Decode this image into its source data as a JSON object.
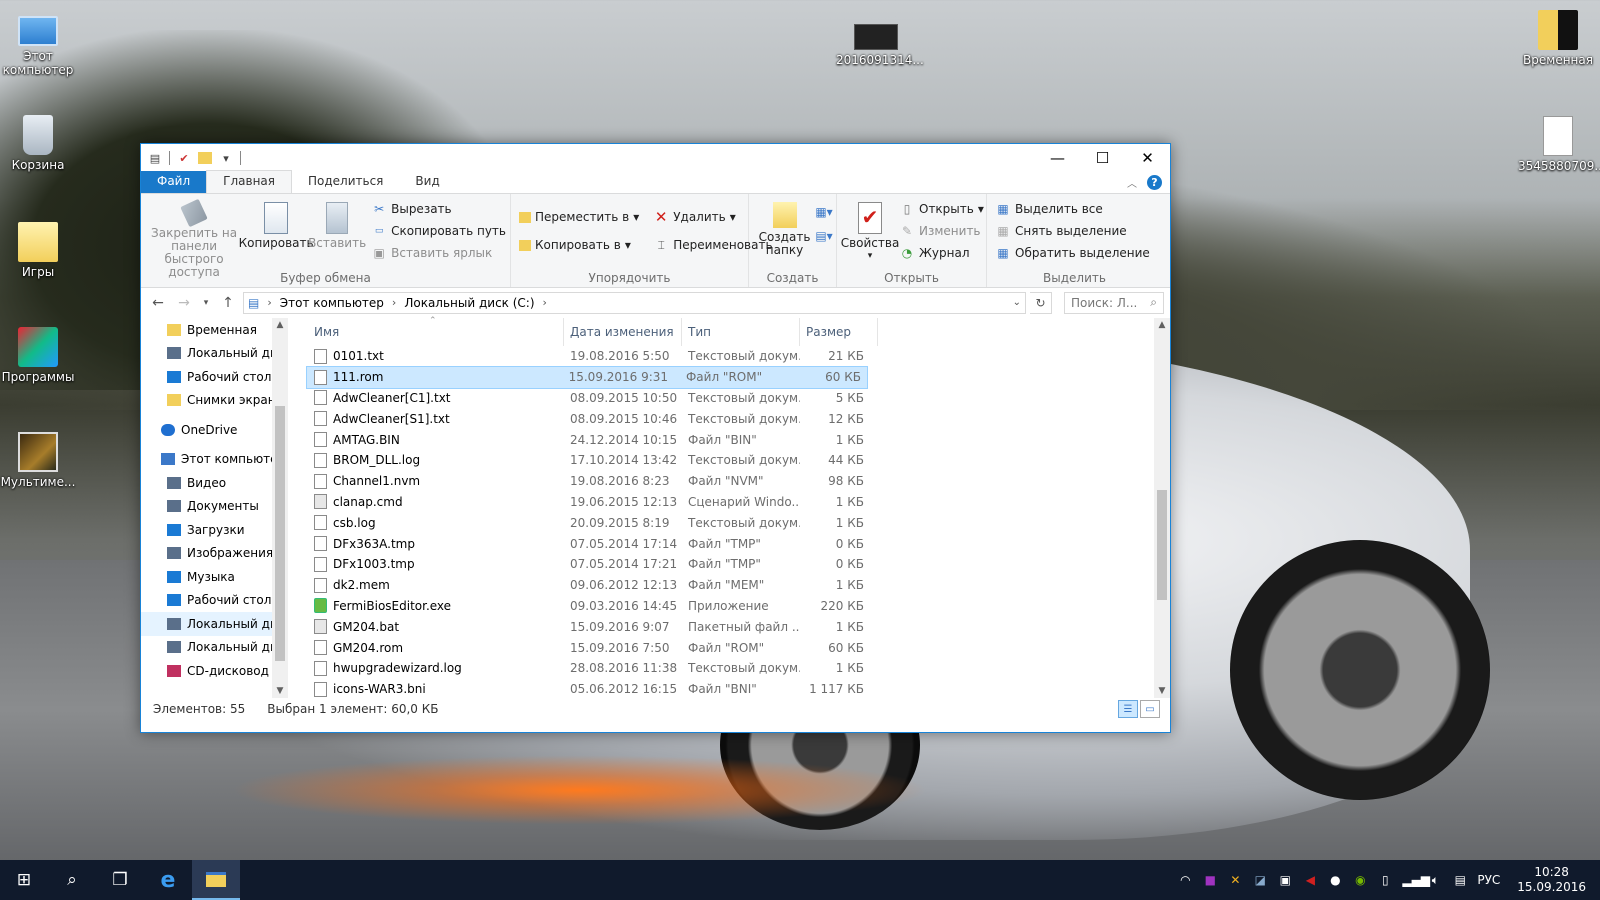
{
  "desktop": {
    "icons": [
      {
        "name": "this-pc",
        "label": "Этот компьютер"
      },
      {
        "name": "recycle-bin",
        "label": "Корзина"
      },
      {
        "name": "games-folder",
        "label": "Игры"
      },
      {
        "name": "programs-folder",
        "label": "Программы"
      },
      {
        "name": "multimedia-folder",
        "label": "Мультиме..."
      },
      {
        "name": "video-file",
        "label": "2016091314..."
      },
      {
        "name": "temp-folder",
        "label": "Временная"
      },
      {
        "name": "text-file",
        "label": "3545880709..."
      }
    ]
  },
  "window": {
    "tabs": [
      "Файл",
      "Главная",
      "Поделиться",
      "Вид"
    ],
    "ribbon": {
      "clipboard": {
        "label": "Буфер обмена",
        "pin": "Закрепить на панели быстрого доступа",
        "copy": "Копировать",
        "paste": "Вставить",
        "cut": "Вырезать",
        "copy_path": "Скопировать путь",
        "paste_shortcut": "Вставить ярлык"
      },
      "organize": {
        "label": "Упорядочить",
        "move_to": "Переместить в",
        "copy_to": "Копировать в",
        "delete": "Удалить",
        "rename": "Переименовать"
      },
      "new": {
        "label": "Создать",
        "new_folder": "Создать папку"
      },
      "open": {
        "label": "Открыть",
        "properties": "Свойства",
        "open": "Открыть",
        "edit": "Изменить",
        "history": "Журнал"
      },
      "select": {
        "label": "Выделить",
        "select_all": "Выделить все",
        "select_none": "Снять выделение",
        "invert": "Обратить выделение"
      }
    },
    "address": {
      "crumbs": [
        "Этот компьютер",
        "Локальный диск (C:)"
      ],
      "search_placeholder": "Поиск: Л..."
    },
    "nav": [
      {
        "label": "Временная",
        "type": "folder"
      },
      {
        "label": "Локальный ди",
        "type": "drive"
      },
      {
        "label": "Рабочий стол",
        "type": "desktop"
      },
      {
        "label": "Снимки экран",
        "type": "folder"
      },
      {
        "label": "OneDrive",
        "type": "cloud",
        "top": true
      },
      {
        "label": "Этот компьютер",
        "type": "pc",
        "top": true
      },
      {
        "label": "Видео",
        "type": "video"
      },
      {
        "label": "Документы",
        "type": "docs"
      },
      {
        "label": "Загрузки",
        "type": "download"
      },
      {
        "label": "Изображения",
        "type": "images"
      },
      {
        "label": "Музыка",
        "type": "music"
      },
      {
        "label": "Рабочий стол",
        "type": "desktop"
      },
      {
        "label": "Локальный ди",
        "type": "drive",
        "selected": true
      },
      {
        "label": "Локальный ди",
        "type": "drive"
      },
      {
        "label": "CD-дисковод (",
        "type": "cd"
      }
    ],
    "columns": {
      "name": "Имя",
      "date": "Дата изменения",
      "type": "Тип",
      "size": "Размер"
    },
    "files": [
      {
        "name": "0101.txt",
        "date": "19.08.2016 5:50",
        "type": "Текстовый докум...",
        "size": "21 КБ",
        "icon": "doc"
      },
      {
        "name": "111.rom",
        "date": "15.09.2016 9:31",
        "type": "Файл \"ROM\"",
        "size": "60 КБ",
        "icon": "blank",
        "selected": true
      },
      {
        "name": "AdwCleaner[C1].txt",
        "date": "08.09.2015 10:50",
        "type": "Текстовый докум...",
        "size": "5 КБ",
        "icon": "doc"
      },
      {
        "name": "AdwCleaner[S1].txt",
        "date": "08.09.2015 10:46",
        "type": "Текстовый докум...",
        "size": "12 КБ",
        "icon": "doc"
      },
      {
        "name": "AMTAG.BIN",
        "date": "24.12.2014 10:15",
        "type": "Файл \"BIN\"",
        "size": "1 КБ",
        "icon": "blank"
      },
      {
        "name": "BROM_DLL.log",
        "date": "17.10.2014 13:42",
        "type": "Текстовый докум...",
        "size": "44 КБ",
        "icon": "doc"
      },
      {
        "name": "Channel1.nvm",
        "date": "19.08.2016 8:23",
        "type": "Файл \"NVM\"",
        "size": "98 КБ",
        "icon": "blank"
      },
      {
        "name": "clanap.cmd",
        "date": "19.06.2015 12:13",
        "type": "Сценарий Windo...",
        "size": "1 КБ",
        "icon": "cmd"
      },
      {
        "name": "csb.log",
        "date": "20.09.2015 8:19",
        "type": "Текстовый докум...",
        "size": "1 КБ",
        "icon": "doc"
      },
      {
        "name": "DFx363A.tmp",
        "date": "07.05.2014 17:14",
        "type": "Файл \"TMP\"",
        "size": "0 КБ",
        "icon": "blank"
      },
      {
        "name": "DFx1003.tmp",
        "date": "07.05.2014 17:21",
        "type": "Файл \"TMP\"",
        "size": "0 КБ",
        "icon": "blank"
      },
      {
        "name": "dk2.mem",
        "date": "09.06.2012 12:13",
        "type": "Файл \"MEM\"",
        "size": "1 КБ",
        "icon": "blank"
      },
      {
        "name": "FermiBiosEditor.exe",
        "date": "09.03.2016 14:45",
        "type": "Приложение",
        "size": "220 КБ",
        "icon": "exe"
      },
      {
        "name": "GM204.bat",
        "date": "15.09.2016 9:07",
        "type": "Пакетный файл ...",
        "size": "1 КБ",
        "icon": "cmd"
      },
      {
        "name": "GM204.rom",
        "date": "15.09.2016 7:50",
        "type": "Файл \"ROM\"",
        "size": "60 КБ",
        "icon": "blank"
      },
      {
        "name": "hwupgradewizard.log",
        "date": "28.08.2016 11:38",
        "type": "Текстовый докум...",
        "size": "1 КБ",
        "icon": "doc"
      },
      {
        "name": "icons-WAR3.bni",
        "date": "05.06.2012 16:15",
        "type": "Файл \"BNI\"",
        "size": "1 117 КБ",
        "icon": "blank"
      }
    ],
    "status": {
      "count": "Элементов: 55",
      "selected": "Выбран 1 элемент: 60,0 КБ"
    }
  },
  "taskbar": {
    "lang": "РУС",
    "time": "10:28",
    "date": "15.09.2016"
  }
}
